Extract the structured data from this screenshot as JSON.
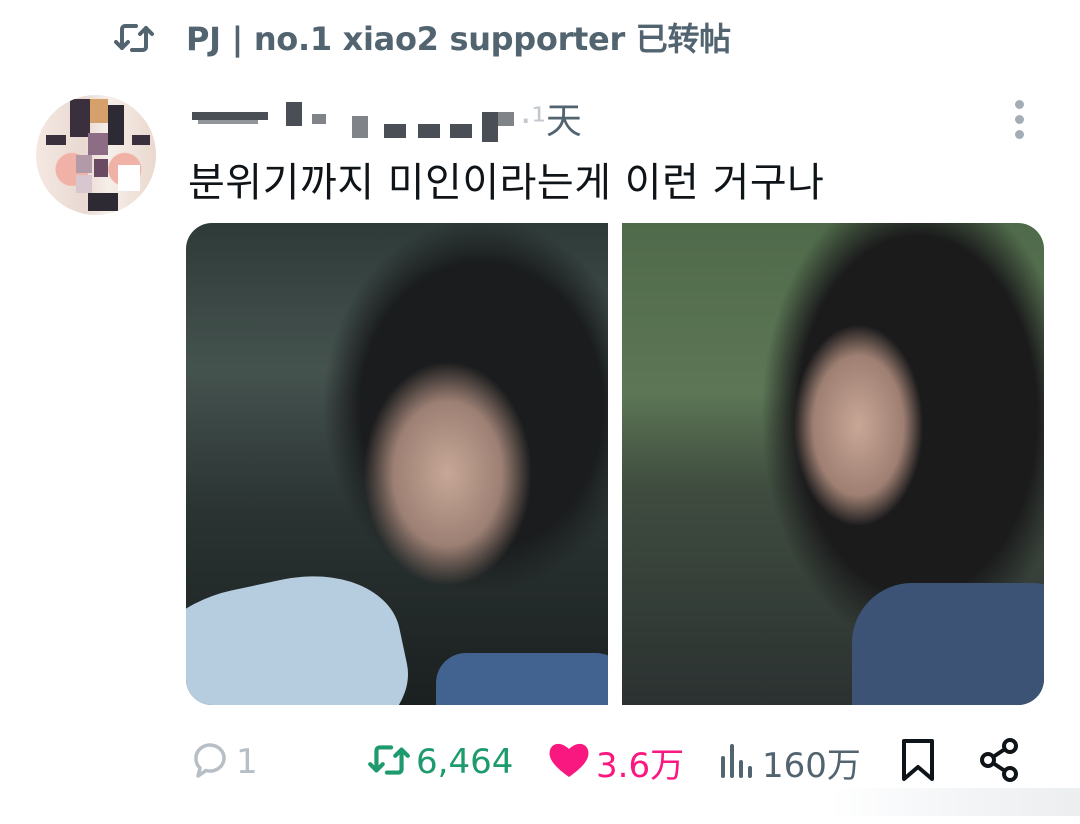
{
  "retweet_header": {
    "icon": "retweet-icon",
    "text": "PJ | no.1 xiao2 supporter 已转帖"
  },
  "tweet": {
    "time_fragment": "天",
    "text": "분위기까지 미인이라는게 이런 거구나",
    "media": [
      "photo-left",
      "photo-right"
    ]
  },
  "actions": {
    "reply_count": "1",
    "retweet_count": "6,464",
    "like_count": "3.6万",
    "view_count": "160万"
  },
  "colors": {
    "header_gray": "#536471",
    "retweet_green": "#1d9b6c",
    "like_pink": "#f91880",
    "reply_gray": "#b7bec5"
  }
}
